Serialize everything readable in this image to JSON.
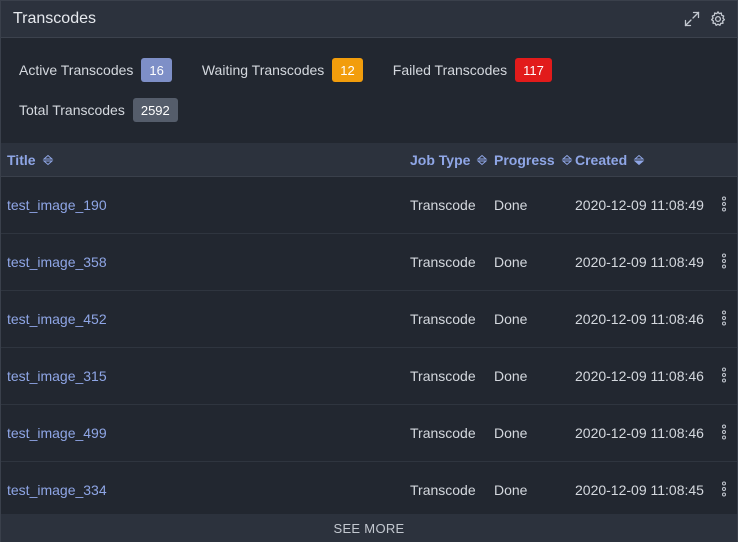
{
  "header": {
    "title": "Transcodes",
    "icons": [
      "expand-icon",
      "gear-icon"
    ]
  },
  "stats": {
    "active": {
      "label": "Active Transcodes",
      "value": "16"
    },
    "waiting": {
      "label": "Waiting Transcodes",
      "value": "12"
    },
    "failed": {
      "label": "Failed Transcodes",
      "value": "117"
    },
    "total": {
      "label": "Total Transcodes",
      "value": "2592"
    }
  },
  "colors": {
    "active_badge": "#7e8fc7",
    "waiting_badge": "#f29d0c",
    "failed_badge": "#e21b1b",
    "total_badge": "#555d6b",
    "link": "#8fa6e6"
  },
  "table": {
    "columns": {
      "title": "Title",
      "job_type": "Job Type",
      "progress": "Progress",
      "created": "Created"
    },
    "rows": [
      {
        "title": "test_image_190",
        "job_type": "Transcode",
        "progress": "Done",
        "created": "2020-12-09 11:08:49"
      },
      {
        "title": "test_image_358",
        "job_type": "Transcode",
        "progress": "Done",
        "created": "2020-12-09 11:08:49"
      },
      {
        "title": "test_image_452",
        "job_type": "Transcode",
        "progress": "Done",
        "created": "2020-12-09 11:08:46"
      },
      {
        "title": "test_image_315",
        "job_type": "Transcode",
        "progress": "Done",
        "created": "2020-12-09 11:08:46"
      },
      {
        "title": "test_image_499",
        "job_type": "Transcode",
        "progress": "Done",
        "created": "2020-12-09 11:08:46"
      },
      {
        "title": "test_image_334",
        "job_type": "Transcode",
        "progress": "Done",
        "created": "2020-12-09 11:08:45"
      }
    ]
  },
  "footer": {
    "see_more_label": "SEE MORE"
  }
}
